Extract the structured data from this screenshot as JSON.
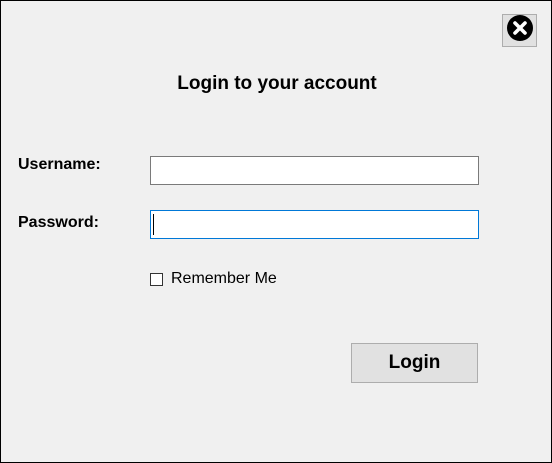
{
  "dialog": {
    "title": "Login to your account",
    "close_icon": "close-circle-x-icon"
  },
  "form": {
    "username": {
      "label": "Username:",
      "value": "",
      "placeholder": ""
    },
    "password": {
      "label": "Password:",
      "value": "",
      "placeholder": "",
      "focused": true
    },
    "remember_me": {
      "label": "Remember Me",
      "checked": false
    },
    "login_button_label": "Login"
  },
  "colors": {
    "window_background": "#f0f0f0",
    "button_face": "#e1e1e1",
    "focus_border": "#0078d7"
  }
}
